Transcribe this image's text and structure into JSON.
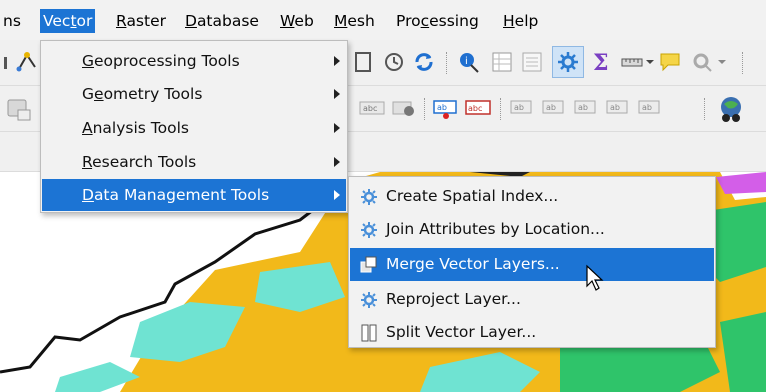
{
  "menubar": {
    "items": [
      {
        "label": "ns",
        "key": "partial"
      },
      {
        "label": "Vector",
        "pre": "Vec",
        "ul": "t",
        "post": "or",
        "active": true
      },
      {
        "label": "Raster",
        "pre": "",
        "ul": "R",
        "post": "aster"
      },
      {
        "label": "Database",
        "pre": "",
        "ul": "D",
        "post": "atabase"
      },
      {
        "label": "Web",
        "pre": "",
        "ul": "W",
        "post": "eb"
      },
      {
        "label": "Mesh",
        "pre": "",
        "ul": "M",
        "post": "esh"
      },
      {
        "label": "Processing",
        "pre": "Pro",
        "ul": "c",
        "post": "essing"
      },
      {
        "label": "Help",
        "pre": "",
        "ul": "H",
        "post": "elp"
      }
    ]
  },
  "vector_menu": {
    "items": [
      {
        "label": "Geoprocessing Tools",
        "pre": "",
        "ul": "G",
        "post": "eoprocessing Tools"
      },
      {
        "label": "Geometry Tools",
        "pre": "G",
        "ul": "e",
        "post": "ometry Tools"
      },
      {
        "label": "Analysis Tools",
        "pre": "",
        "ul": "A",
        "post": "nalysis Tools"
      },
      {
        "label": "Research Tools",
        "pre": "",
        "ul": "R",
        "post": "esearch Tools"
      },
      {
        "label": "Data Management Tools",
        "pre": "",
        "ul": "D",
        "post": "ata Management Tools",
        "highlighted": true
      }
    ]
  },
  "data_management_submenu": {
    "items": [
      {
        "label": "Create Spatial Index...",
        "icon": "gear-cog-icon"
      },
      {
        "label": "Join Attributes by Location...",
        "icon": "gear-cog-icon"
      },
      {
        "label": "Merge Vector Layers...",
        "icon": "merge-layers-icon",
        "highlighted": true
      },
      {
        "label": "Reproject Layer...",
        "icon": "gear-cog-icon"
      },
      {
        "label": "Split Vector Layer...",
        "icon": "split-layer-icon"
      }
    ]
  },
  "toolbar_labels": {
    "abc": "abc",
    "ab": "ab"
  },
  "colors": {
    "highlight": "#1c74d4",
    "map_orange": "#f2b91a",
    "map_cyan": "#6fe3d2",
    "map_green": "#2fc46a",
    "map_magenta": "#d35ee8"
  }
}
